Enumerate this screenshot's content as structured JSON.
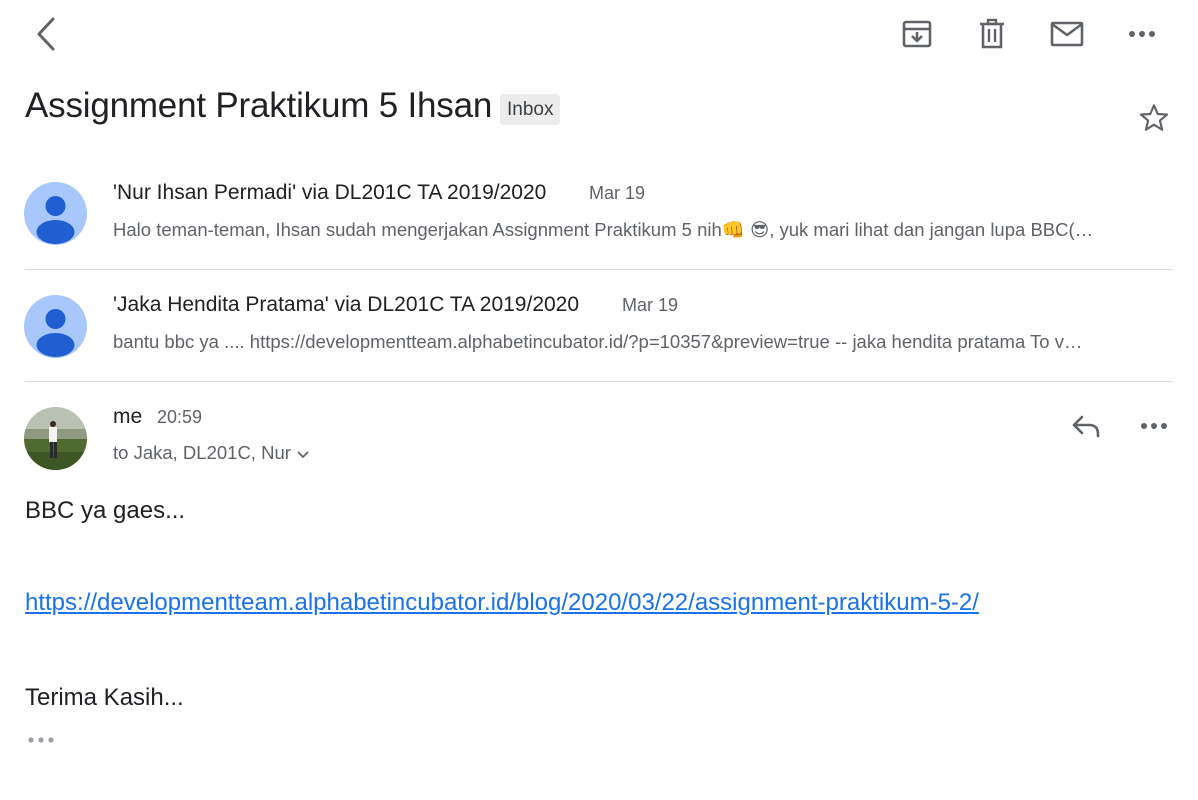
{
  "thread": {
    "subject": "Assignment Praktikum 5 Ihsan",
    "label": "Inbox"
  },
  "messages": [
    {
      "sender": "'Nur Ihsan Permadi' via DL201C TA 2019/2020",
      "date": "Mar 19",
      "snippet": "Halo teman-teman, Ihsan sudah mengerjakan Assignment Praktikum 5 nih👊 😎, yuk mari lihat dan jangan lupa BBC(…"
    },
    {
      "sender": "'Jaka Hendita Pratama' via DL201C TA 2019/2020",
      "date": "Mar 19",
      "snippet": "bantu bbc ya .... https://developmentteam.alphabetincubator.id/?p=10357&preview=true -- jaka hendita pratama To v…"
    }
  ],
  "open_message": {
    "sender": "me",
    "time": "20:59",
    "recipients": "to Jaka, DL201C, Nur",
    "body_line1": "BBC ya gaes...",
    "link": "https://developmentteam.alphabetincubator.id/blog/2020/03/22/assignment-praktikum-5-2/",
    "body_line3": "Terima Kasih..."
  },
  "icons": {
    "back": "back-arrow-icon",
    "archive": "archive-icon",
    "delete": "trash-icon",
    "mark_unread": "mail-icon",
    "more": "more-horizontal-icon",
    "star": "star-outline-icon",
    "reply": "reply-icon",
    "expand": "chevron-down-icon"
  },
  "colors": {
    "link": "#1a73e8",
    "avatar_default": "#a8c7fa",
    "avatar_person": "#1f5fd1",
    "chip_bg": "#ececec"
  }
}
